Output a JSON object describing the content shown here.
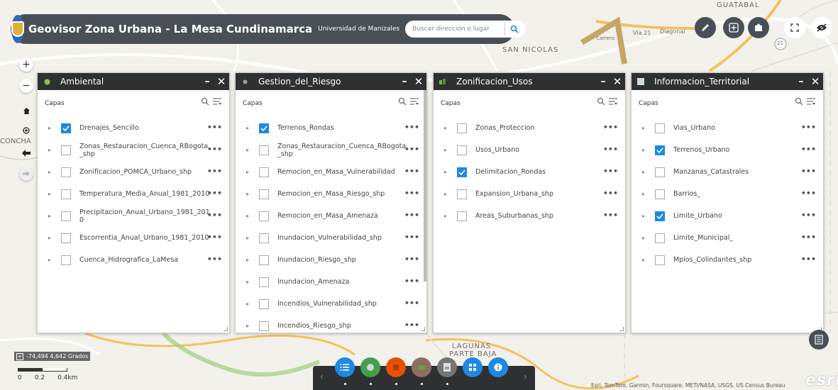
{
  "header": {
    "title": "Geovisor Zona Urbana - La Mesa Cundinamarca",
    "subtitle": "Universidad de Manizales",
    "search_placeholder": "Buscar dirección o lugar"
  },
  "map_labels": {
    "san_nicolas": "SAN NICOLAS",
    "guatabal": "GUATABAL",
    "lagunas": "LAGUNAS",
    "parte_baja": "PARTE BAJA",
    "concha": "CONCHA",
    "via_21": "Vía 21",
    "diagonal": "Diagonal",
    "carrera": "Carrera",
    "route": "21"
  },
  "panels": [
    {
      "title": "Ambiental",
      "capas": "Capas",
      "layers": [
        {
          "label": "Drenajes_Sencillo",
          "checked": true
        },
        {
          "label": "Zonas_Restauracion_Cuenca_RBogota _shp",
          "checked": false
        },
        {
          "label": "Zonificacion_POMCA_Urbano_shp",
          "checked": false
        },
        {
          "label": "Temperatura_Media_Anual_1981_2010",
          "checked": false
        },
        {
          "label": "Precipitacion_Anual_Urbano_1981_201 0",
          "checked": false
        },
        {
          "label": "Escorrentia_Anual_Urbano_1981_2010",
          "checked": false
        },
        {
          "label": "Cuenca_Hidrografica_LaMesa",
          "checked": false
        }
      ]
    },
    {
      "title": "Gestion_del_Riesgo",
      "capas": "Capas",
      "layers": [
        {
          "label": "Terrenos_Rondas",
          "checked": true
        },
        {
          "label": "Zonas_Restauracion_Cuenca_RBogota _shp",
          "checked": false
        },
        {
          "label": "Remocion_en_Masa_Vulnerabilidad",
          "checked": false
        },
        {
          "label": "Remocion_en_Masa_Riesgo_shp",
          "checked": false
        },
        {
          "label": "Remocion_en_Masa_Amenaza",
          "checked": false
        },
        {
          "label": "Inundacion_Vulnerabilidad_shp",
          "checked": false
        },
        {
          "label": "Inundacion_Riesgo_shp",
          "checked": false
        },
        {
          "label": "Inundacion_Amenaza",
          "checked": false
        },
        {
          "label": "Incendios_Vulnerabilidad_shp",
          "checked": false
        },
        {
          "label": "Incendios_Riesgo_shp",
          "checked": false
        }
      ]
    },
    {
      "title": "Zonificacion_Usos",
      "capas": "Capas",
      "layers": [
        {
          "label": "Zonas_Proteccion",
          "checked": false
        },
        {
          "label": "Usos_Urbano",
          "checked": false
        },
        {
          "label": "Delimitacion_Rondas",
          "checked": true
        },
        {
          "label": "Expansion_Urbana_shp",
          "checked": false
        },
        {
          "label": "Areas_Suburbanas_shp",
          "checked": false
        }
      ]
    },
    {
      "title": "Informacion_Territorial",
      "capas": "Capas",
      "layers": [
        {
          "label": "Vias_Urbano",
          "checked": false
        },
        {
          "label": "Terrenos_Urbano",
          "checked": true
        },
        {
          "label": "Manzanas_Catastrales",
          "checked": false
        },
        {
          "label": "Barrios_",
          "checked": false
        },
        {
          "label": "Limite_Urbano",
          "checked": true
        },
        {
          "label": "Limite_Municipal_",
          "checked": false
        },
        {
          "label": "Mpios_Colindantes_shp",
          "checked": false
        }
      ]
    }
  ],
  "panel_controls": {
    "minimize": "–",
    "close": "✕",
    "more": "•••"
  },
  "coords": "-74,494 4,642 Grados",
  "scale": {
    "l0": "0",
    "l1": "0.2",
    "l2": "0.4km"
  },
  "attribution": "Esri, TomTom, Garmin, Foursquare, METI/NASA, USGS, US Census Bureau",
  "esri_logo": "esri",
  "toolbar_colors": [
    "#1e88e5",
    "#43a047",
    "#e65100",
    "#8d6e63",
    "#757575",
    "#1e88e5",
    "#1e88e5"
  ]
}
